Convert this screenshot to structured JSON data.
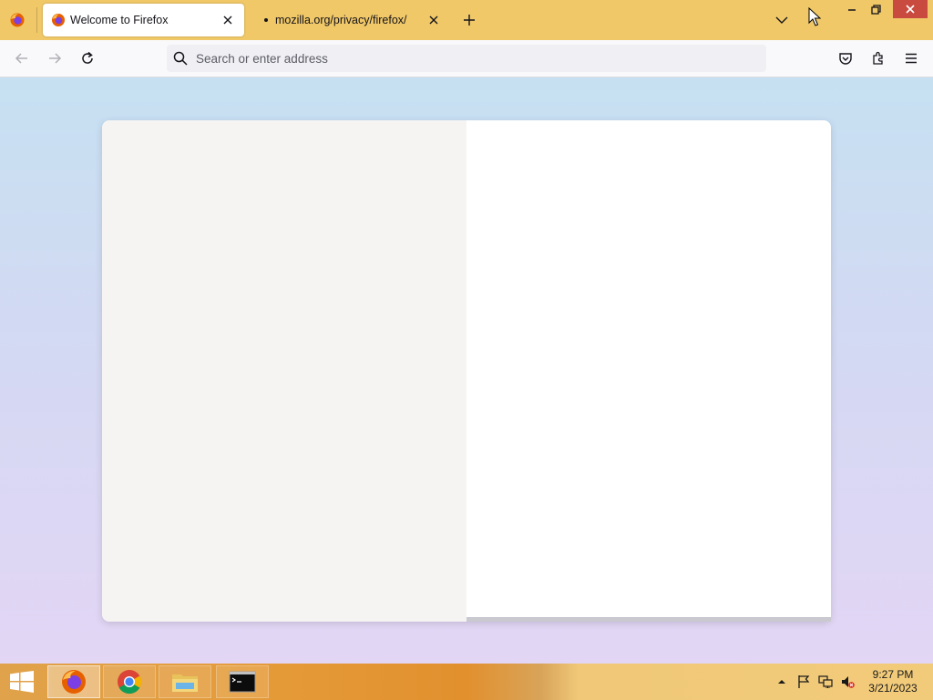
{
  "browser": {
    "tabs": [
      {
        "title": "Welcome to Firefox",
        "active": true,
        "favicon": "firefox-icon"
      },
      {
        "title": "mozilla.org/privacy/firefox/",
        "active": false,
        "favicon": "loading-dot-icon"
      }
    ],
    "address_bar": {
      "placeholder": "Search or enter address",
      "value": ""
    },
    "toolbar_icons": [
      "back-icon",
      "forward-icon",
      "reload-icon",
      "pocket-icon",
      "extensions-icon",
      "menu-icon"
    ],
    "accent_color": "#f0c868"
  },
  "taskbar": {
    "apps": [
      "firefox-icon",
      "chrome-icon",
      "file-explorer-icon",
      "command-prompt-icon"
    ],
    "tray_icons": [
      "show-hidden-icons",
      "action-center-flag-icon",
      "network-icon",
      "volume-muted-icon"
    ],
    "clock": {
      "time": "9:27 PM",
      "date": "3/21/2023"
    }
  }
}
